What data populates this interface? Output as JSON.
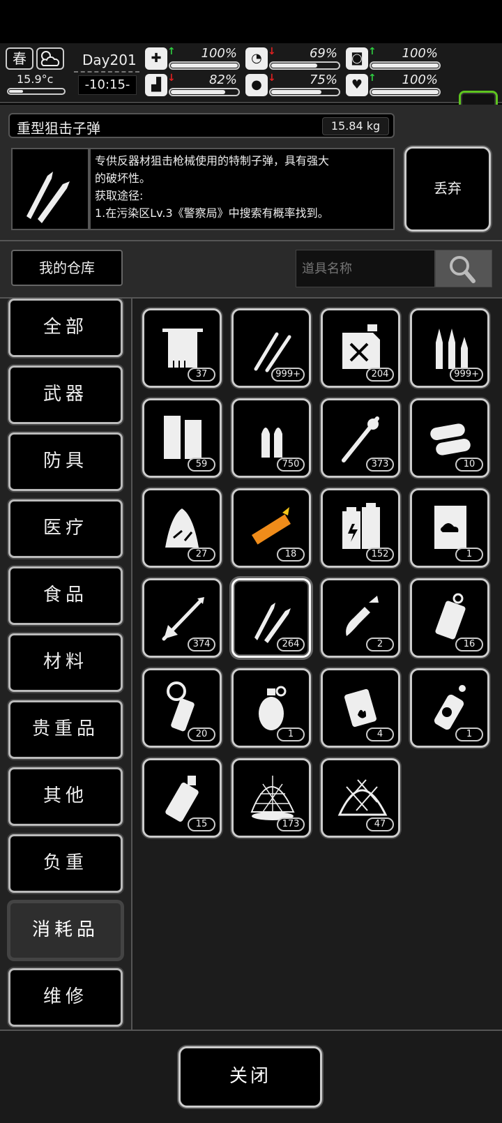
{
  "hud": {
    "season": "春",
    "temperature": "15.9°c",
    "day": "Day201",
    "time": "-10:15-",
    "stats": [
      {
        "name": "health",
        "icon": "first-aid-icon",
        "arrow": "↑",
        "trend": "up",
        "value": "100%",
        "level": 100
      },
      {
        "name": "hunger",
        "icon": "stomach-icon",
        "arrow": "↓",
        "trend": "down",
        "value": "69%",
        "level": 69
      },
      {
        "name": "mental",
        "icon": "brain-icon",
        "arrow": "↑",
        "trend": "up",
        "value": "100%",
        "level": 100
      },
      {
        "name": "stamina",
        "icon": "foot-icon",
        "arrow": "↓",
        "trend": "down",
        "value": "82%",
        "level": 82
      },
      {
        "name": "thirst",
        "icon": "water-drop-icon",
        "arrow": "↓",
        "trend": "down",
        "value": "75%",
        "level": 75
      },
      {
        "name": "mood",
        "icon": "heart-icon",
        "arrow": "↑",
        "trend": "up",
        "value": "100%",
        "level": 100
      }
    ]
  },
  "item": {
    "name": "重型狙击子弹",
    "weight": "15.84 kg",
    "description": [
      "专供反器材狙击枪械使用的特制子弹，具有强大",
      "的破坏性。",
      "获取途径:",
      "1.在污染区Lv.3《警察局》中搜索有概率找到。"
    ],
    "discard_label": "丢弃"
  },
  "warehouse": {
    "title": "我的仓库",
    "search_placeholder": "道具名称"
  },
  "categories": [
    "全部",
    "武器",
    "防具",
    "医疗",
    "食品",
    "材料",
    "贵重品",
    "其他",
    "负重",
    "消耗品",
    "维修"
  ],
  "active_category": "消耗品",
  "grid_items": [
    {
      "icon": "towel-icon",
      "count": "37"
    },
    {
      "icon": "lockpick-icon",
      "count": "999+"
    },
    {
      "icon": "fuel-canister-icon",
      "count": "204"
    },
    {
      "icon": "rifle-bullets-icon",
      "count": "999+"
    },
    {
      "icon": "magazine-icon",
      "count": "59"
    },
    {
      "icon": "pistol-bullets-icon",
      "count": "750"
    },
    {
      "icon": "rocket-icon",
      "count": "373"
    },
    {
      "icon": "shotgun-shells-icon",
      "count": "10"
    },
    {
      "icon": "bandage-icon",
      "count": "27"
    },
    {
      "icon": "crayon-icon",
      "count": "18"
    },
    {
      "icon": "battery-icon",
      "count": "152"
    },
    {
      "icon": "book-icon",
      "count": "1"
    },
    {
      "icon": "arrow-icon",
      "count": "374"
    },
    {
      "icon": "sniper-bullets-icon",
      "count": "264",
      "selected": true
    },
    {
      "icon": "molotov-icon",
      "count": "2"
    },
    {
      "icon": "smoke-grenade-icon",
      "count": "16"
    },
    {
      "icon": "flash-grenade-icon",
      "count": "20"
    },
    {
      "icon": "frag-grenade-icon",
      "count": "1"
    },
    {
      "icon": "incendiary-grenade-icon",
      "count": "4"
    },
    {
      "icon": "nuke-spray-icon",
      "count": "1"
    },
    {
      "icon": "stun-grenade-icon",
      "count": "15"
    },
    {
      "icon": "spider-net-icon",
      "count": "173"
    },
    {
      "icon": "net-trap-icon",
      "count": "47"
    }
  ],
  "close_label": "关闭"
}
